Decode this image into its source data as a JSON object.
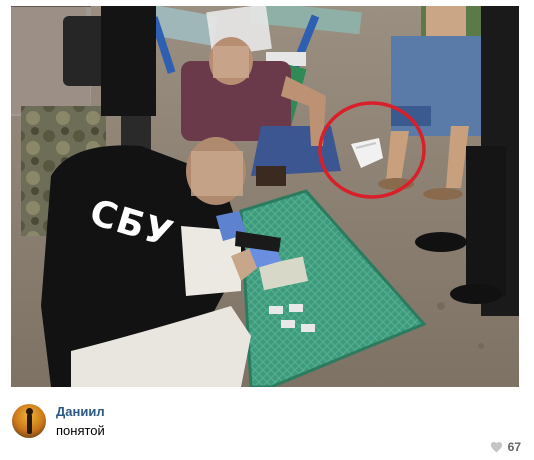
{
  "post": {
    "photo_overlay_text": "СБУ",
    "author_name": "Даниил",
    "caption": "понятой",
    "likes_count": "67",
    "icons": {
      "like": "heart-icon",
      "avatar": "user-avatar"
    },
    "colors": {
      "author": "#2a5885",
      "annotation_circle": "#d9202a",
      "likes": "#656565"
    }
  }
}
